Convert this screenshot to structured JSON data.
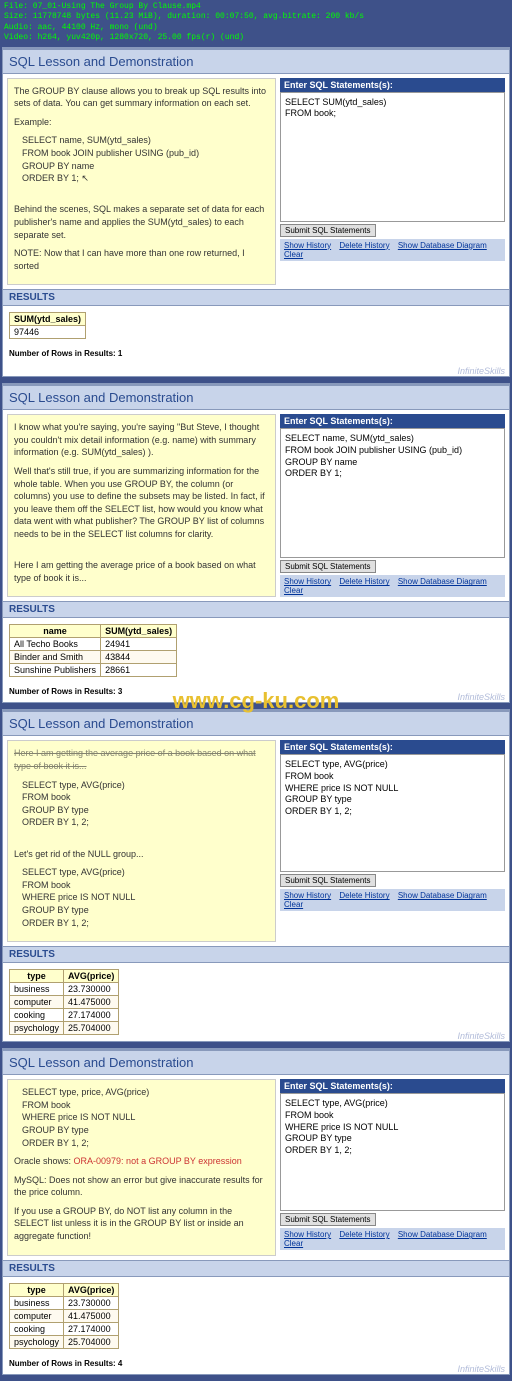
{
  "file_info": {
    "l1": "File: 07_01-Using The Group By Clause.mp4",
    "l2": "Size: 11778748 bytes (11.23 MiB), duration: 00:07:50, avg.bitrate: 200 kb/s",
    "l3": "Audio: aac, 44100 Hz, mono (und)",
    "l4": "Video: h264, yuv420p, 1280x720, 25.00 fps(r) (und)"
  },
  "title": "SQL Lesson and Demonstration",
  "sql_header": "Enter SQL Statements(s):",
  "submit_label": "Submit SQL Statements",
  "links": {
    "history": "Show History",
    "delhist": "Delete History",
    "showdb": "Show Database Diagram",
    "clear": "Clear"
  },
  "results_label": "RESULTS",
  "watermark": "InfiniteSkills",
  "big_watermark": "www.cg-ku.com",
  "p1": {
    "note1": "The GROUP BY clause allows you to break up SQL results into sets of data.  You can get summary information on each set.",
    "example_label": "Example:",
    "q1": "SELECT name, SUM(ytd_sales)",
    "q2": "FROM book JOIN publisher USING (pub_id)",
    "q3": "GROUP BY name",
    "q4": "ORDER BY 1;",
    "note2": "Behind the scenes, SQL makes a separate set of data for each publisher's name and applies the SUM(ytd_sales) to each separate set.",
    "note3": "NOTE:  Now that I can have more than one row returned, I sorted",
    "sql": "SELECT SUM(ytd_sales)\nFROM book;",
    "th1": "SUM(ytd_sales)",
    "r1c1": "97446",
    "rows": "Number of Rows in Results: 1"
  },
  "p2": {
    "note1": "I know what you're saying, you're saying \"But Steve, I thought you couldn't mix detail information (e.g. name) with summary information (e.g. SUM(ytd_sales) ).",
    "note2": "Well that's still true, if you are summarizing information for the whole table.  When you use GROUP BY, the column (or columns) you use to define the subsets may be listed.  In fact, if you leave them off the SELECT list, how would you know what data went with what publisher?   The GROUP BY list of columns needs to be in the SELECT list columns for clarity.",
    "note3": "Here I am getting the average price of a book based on what type of book it is...",
    "sql": "SELECT name, SUM(ytd_sales)\nFROM book JOIN publisher USING (pub_id)\nGROUP BY name\nORDER BY 1;",
    "th1": "name",
    "th2": "SUM(ytd_sales)",
    "r1c1": "All Techo Books",
    "r1c2": "24941",
    "r2c1": "Binder and Smith",
    "r2c2": "43844",
    "r3c1": "Sunshine Publishers",
    "r3c2": "28661",
    "rows": "Number of Rows in Results: 3"
  },
  "p3": {
    "top": "Here I am getting the average price of a book based on what type of book it is...",
    "q1": "SELECT type, AVG(price)",
    "q2": "FROM book",
    "q3": "GROUP BY type",
    "q4": "ORDER BY 1, 2;",
    "note2": "Let's get rid of the NULL group...",
    "q5": "SELECT type, AVG(price)",
    "q6": "FROM book",
    "q7": "WHERE price IS NOT NULL",
    "q8": "GROUP BY type",
    "q9": "ORDER BY 1, 2;",
    "sql": "SELECT type, AVG(price)\n FROM book\n WHERE price IS NOT NULL\n GROUP BY type\n ORDER BY 1, 2;",
    "th1": "type",
    "th2": "AVG(price)",
    "r1c1": "business",
    "r1c2": "23.730000",
    "r2c1": "computer",
    "r2c2": "41.475000",
    "r3c1": "cooking",
    "r3c2": "27.174000",
    "r4c1": "psychology",
    "r4c2": "25.704000"
  },
  "p4": {
    "q1": "SELECT type, price, AVG(price)",
    "q2": "FROM book",
    "q3": "WHERE price IS NOT NULL",
    "q4": "GROUP BY type",
    "q5": "ORDER BY 1, 2;",
    "ora_pre": "Oracle shows:  ",
    "ora_err": "ORA-00979: not a GROUP BY expression",
    "note2": "MySQL: Does not show an error but give inaccurate results for the price column.",
    "note3": "If you use a GROUP BY, do NOT list any column in the SELECT list unless it is in the GROUP BY list or inside an aggregate function!",
    "sql": "SELECT type, AVG(price)\nFROM book\nWHERE price IS NOT NULL\nGROUP BY type\nORDER BY 1, 2;",
    "th1": "type",
    "th2": "AVG(price)",
    "r1c1": "business",
    "r1c2": "23.730000",
    "r2c1": "computer",
    "r2c2": "41.475000",
    "r3c1": "cooking",
    "r3c2": "27.174000",
    "r4c1": "psychology",
    "r4c2": "25.704000",
    "rows": "Number of Rows in Results: 4"
  }
}
